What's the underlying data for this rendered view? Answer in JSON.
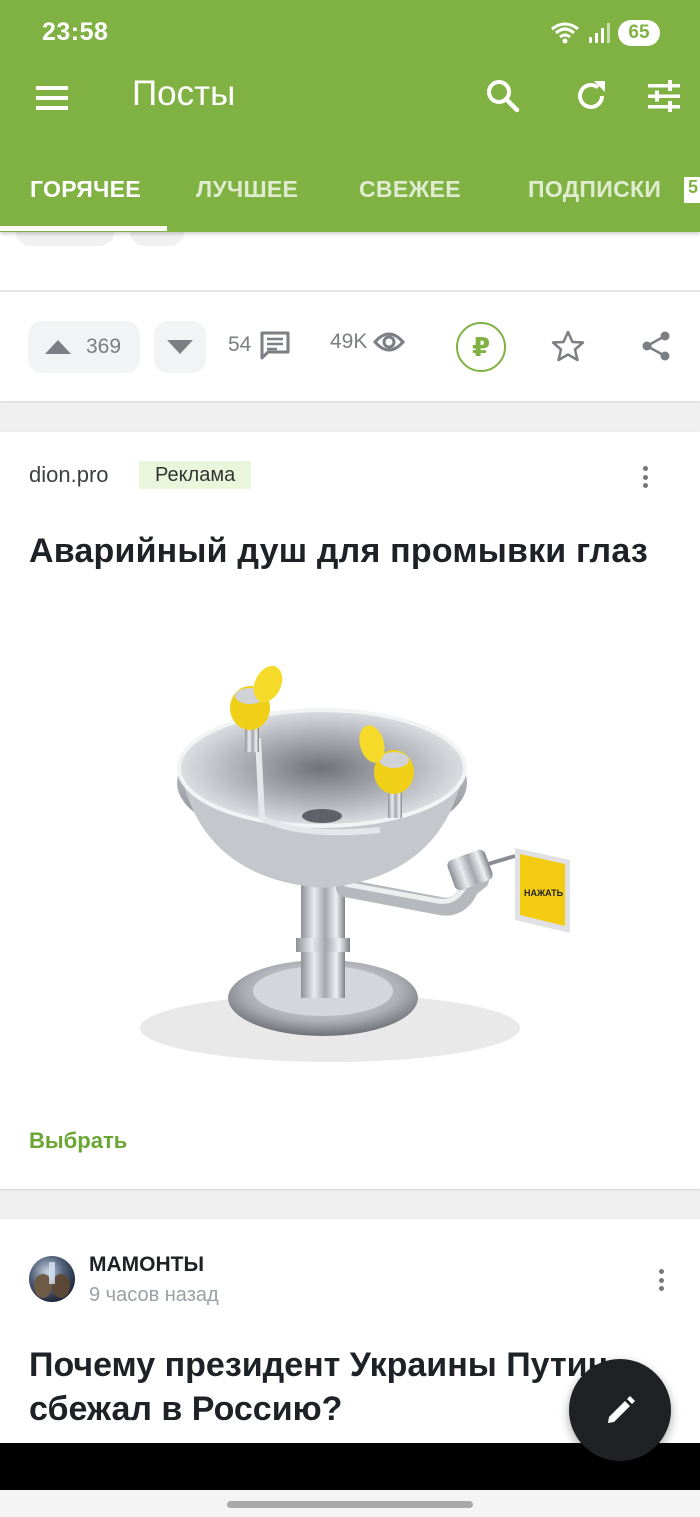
{
  "status_bar": {
    "time": "23:58",
    "battery": "65"
  },
  "app_bar": {
    "title": "Посты"
  },
  "tabs": [
    {
      "label": "ГОРЯЧЕЕ",
      "active": true
    },
    {
      "label": "ЛУЧШЕЕ"
    },
    {
      "label": "СВЕЖЕЕ"
    },
    {
      "label": "ПОДПИСКИ"
    }
  ],
  "tab_badge": "5",
  "prev_post": {
    "upvotes": "369",
    "comments": "54",
    "views": "49K",
    "donate_symbol": "₽"
  },
  "ad": {
    "source": "dion.pro",
    "badge": "Реклама",
    "title": "Аварийный душ для промывки глаз",
    "sign_text": "НАЖАТЬ",
    "cta": "Выбрать"
  },
  "post": {
    "author": "МАМОНТЫ",
    "time": "9 часов назад",
    "title": "Почему президент Украины Путин сбежал в Россию?"
  },
  "colors": {
    "brand": "#80b243",
    "accent_text": "#6aa632",
    "ad_badge_bg": "#eaf6dc"
  }
}
